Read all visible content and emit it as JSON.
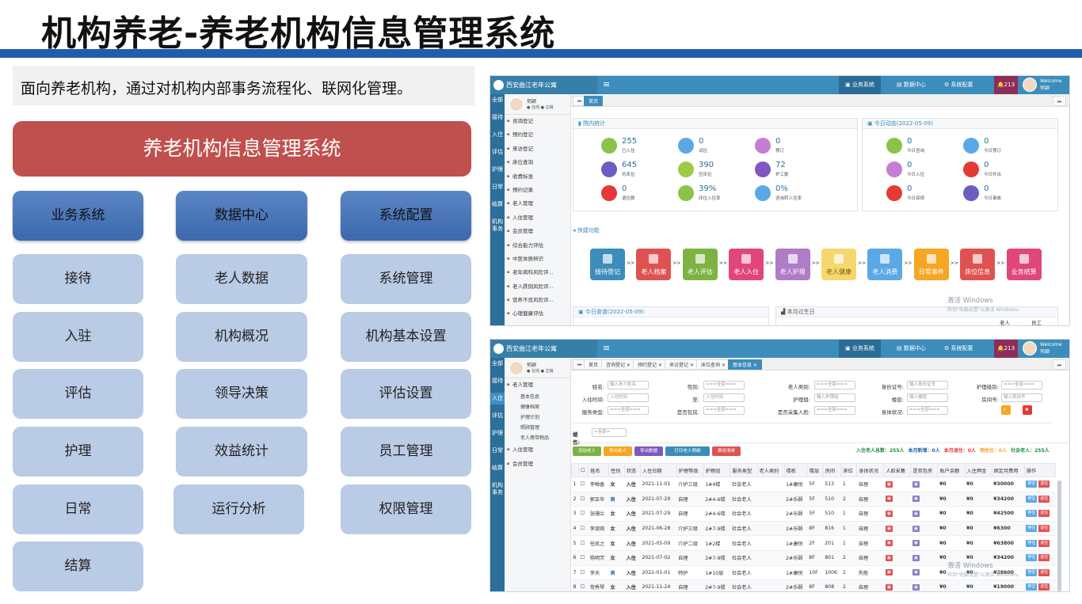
{
  "slide": {
    "title": "机构养老-养老机构信息管理系统",
    "intro": "面向养老机构，通过对机构内部事务流程化、联网化管理。",
    "banner": "养老机构信息管理系统"
  },
  "modules": {
    "headers": [
      "业务系统",
      "数据中心",
      "系统配置"
    ],
    "col1": [
      "接待",
      "入驻",
      "评估",
      "护理",
      "日常",
      "结算"
    ],
    "col2": [
      "老人数据",
      "机构概况",
      "领导决策",
      "效益统计",
      "运行分析"
    ],
    "col3": [
      "系统管理",
      "机构基本设置",
      "评估设置",
      "员工管理",
      "权限管理"
    ]
  },
  "app": {
    "logo_text": "西安曲江老年公寓",
    "nav": [
      "业务系统",
      "数据中心",
      "系统配置"
    ],
    "bell_count": "213",
    "welcome": "Welcome",
    "user": "何颖",
    "status_online": "在线",
    "status_logout": "注销",
    "leftbar": [
      "全部",
      "接待",
      "入住",
      "评估",
      "护理",
      "日常",
      "结算",
      "机构事务"
    ],
    "watermark": "激活 Windows",
    "watermark_sub": "转到\"电脑设置\"以激活 Windows。"
  },
  "shot1": {
    "tabs": [
      "首页"
    ],
    "sidebar": [
      "咨询登记",
      "预约登记",
      "来访登记",
      "床位查询",
      "收费标准",
      "预约记录",
      "老人管理",
      "入住管理",
      "会员管理",
      "综合能力评估",
      "中医体质辨识",
      "老年病科风险评...",
      "老人跌倒风险评...",
      "营养不良风险评...",
      "心理健康评估"
    ],
    "stats_title": "院内统计",
    "stats": [
      {
        "value": "255",
        "label": "已入住",
        "color": "#8bc34a"
      },
      {
        "value": "0",
        "label": "试住",
        "color": "#5aa9e6"
      },
      {
        "value": "0",
        "label": "预订",
        "color": "#c77dd3"
      },
      {
        "value": "645",
        "label": "总床位",
        "color": "#6a5fc1"
      },
      {
        "value": "390",
        "label": "空床位",
        "color": "#9ccc45"
      },
      {
        "value": "72",
        "label": "护工数",
        "color": "#7e57c2"
      },
      {
        "value": "0",
        "label": "退住数",
        "color": "#e53935"
      },
      {
        "value": "39%",
        "label": "床位入住率",
        "color": "#8bc34a"
      },
      {
        "value": "0%",
        "label": "咨询转入住率",
        "color": "#5aa9e6"
      }
    ],
    "today_title": "今日动态(2022-05-09)",
    "today": [
      {
        "value": "0",
        "label": "今日咨询",
        "color": "#8bc34a"
      },
      {
        "value": "0",
        "label": "今日预订",
        "color": "#5aa9e6"
      },
      {
        "value": "0",
        "label": "今日入住",
        "color": "#c77dd3"
      },
      {
        "value": "0",
        "label": "今日外出",
        "color": "#e53935"
      },
      {
        "value": "0",
        "label": "今日探视",
        "color": "#e53935"
      },
      {
        "value": "0",
        "label": "今日事故",
        "color": "#6a5fc1"
      }
    ],
    "quick_title": "快捷功能",
    "quick": [
      {
        "label": "接待登记",
        "color": "#3c8dbc"
      },
      {
        "label": "老人档案",
        "color": "#e05252"
      },
      {
        "label": "老人评估",
        "color": "#7cb342"
      },
      {
        "label": "老人入住",
        "color": "#e0457b"
      },
      {
        "label": "老人护理",
        "color": "#b07cc6"
      },
      {
        "label": "老人健康",
        "color": "#f5d76e"
      },
      {
        "label": "老人消费",
        "color": "#5aa9e6"
      },
      {
        "label": "日常事件",
        "color": "#f5a623"
      },
      {
        "label": "床位信息",
        "color": "#e05252"
      },
      {
        "label": "业务结算",
        "color": "#e0457b"
      }
    ],
    "menu_title": "今日食谱(2022-05-09)",
    "birthday_title": "本月过生日",
    "birthday_cols": [
      "老人",
      "员工"
    ]
  },
  "shot2": {
    "tabs": [
      "首页",
      "咨询登记",
      "预约登记",
      "来访登记",
      "床位查询",
      "基本信息"
    ],
    "sidebar_head": "老人管理",
    "sidebar_sub": [
      "基本信息",
      "健康档案",
      "护理计划",
      "照顾管理",
      "老人携带物品"
    ],
    "sidebar_more": [
      "入住管理",
      "会员管理"
    ],
    "form": {
      "name_label": "姓名:",
      "name_ph": "输入老人姓名",
      "sex_label": "性别:",
      "sex_val": "===全部===",
      "type_label": "老人类别:",
      "type_val": "===全部===",
      "id_label": "身份证号:",
      "id_ph": "输入身份证号",
      "level_label": "护理级别:",
      "level_val": "===全部===",
      "time_label": "入住时间:",
      "time_ph": "入住时间",
      "to_label": "至:",
      "to_ph": "入住时间",
      "group_label": "护理组:",
      "group_ph": "输入护理组",
      "floor_label": "楼层:",
      "floor_ph": "输入楼层",
      "room_label": "房间号:",
      "room_ph": "输入房间号",
      "svc_label": "服务类型:",
      "svc_val": "===全部===",
      "pkg_label": "是否包房:",
      "pkg_val": "===全部===",
      "face_label": "是否采集人脸:",
      "face_val": "===全部===",
      "body_label": "身体状况:",
      "body_val": "===全部===",
      "query_btn": "查询",
      "reset_btn": "重置",
      "building_label": "楼栋:",
      "building_val": "=全部="
    },
    "actions": [
      "添加老人",
      "导出老人",
      "导出数据",
      "打印老人明细",
      "费用清单"
    ],
    "summary": [
      {
        "text": "入住老人总数：255人",
        "color": "#1e8e3e"
      },
      {
        "text": "本月新增：0人",
        "color": "#1f5db0"
      },
      {
        "text": "本月退住：0人",
        "color": "#e53935"
      },
      {
        "text": "预收住：0人",
        "color": "#f5a623"
      },
      {
        "text": "社会老人：255人",
        "color": "#1e8e3e"
      }
    ],
    "columns": [
      "",
      "",
      "姓名",
      "性别",
      "状态",
      "入住日期",
      "护理等级",
      "护理组",
      "服务类型",
      "老人类别",
      "楼栋",
      "楼层",
      "房间",
      "床位",
      "身体状况",
      "人脸采集",
      "是否包房",
      "账户余额",
      "入住押金",
      "固定月费用",
      "操作"
    ],
    "rows": [
      {
        "no": "1",
        "name": "李梅香",
        "sex": "女",
        "status": "入住",
        "date": "2021-11-01",
        "level": "介护三级",
        "group": "1#4楼",
        "svc": "社会老人",
        "type": "",
        "bld": "1#康悦",
        "floor": "5F",
        "room": "513",
        "bed": "1",
        "body": "自理",
        "bal": "¥0",
        "dep": "¥0",
        "fee": "¥30000"
      },
      {
        "no": "2",
        "name": "郭正华",
        "sex": "男",
        "status": "入住",
        "date": "2021-07-29",
        "level": "自理",
        "group": "2#4-6楼",
        "svc": "社会老人",
        "type": "",
        "bld": "2#乐颐",
        "floor": "5F",
        "room": "510",
        "bed": "2",
        "body": "自理",
        "bal": "¥0",
        "dep": "¥0",
        "fee": "¥34200"
      },
      {
        "no": "3",
        "name": "张珊兰",
        "sex": "女",
        "status": "入住",
        "date": "2021-07-29",
        "level": "自理",
        "group": "2#4-6楼",
        "svc": "社会老人",
        "type": "",
        "bld": "2#乐颐",
        "floor": "5F",
        "room": "510",
        "bed": "1",
        "body": "自理",
        "bal": "¥0",
        "dep": "¥0",
        "fee": "¥42500"
      },
      {
        "no": "4",
        "name": "李淑琦",
        "sex": "女",
        "status": "入住",
        "date": "2021-06-28",
        "level": "介护三级",
        "group": "2#7-9楼",
        "svc": "社会老人",
        "type": "",
        "bld": "2#乐颐",
        "floor": "8F",
        "room": "816",
        "bed": "1",
        "body": "自理",
        "bal": "¥0",
        "dep": "¥0",
        "fee": "¥6300"
      },
      {
        "no": "5",
        "name": "任凯之",
        "sex": "女",
        "status": "入住",
        "date": "2021-05-09",
        "level": "介护二级",
        "group": "1#2楼",
        "svc": "社会老人",
        "type": "",
        "bld": "1#康悦",
        "floor": "2F",
        "room": "201",
        "bed": "1",
        "body": "自理",
        "bal": "¥0",
        "dep": "¥0",
        "fee": "¥63800"
      },
      {
        "no": "6",
        "name": "杨明芳",
        "sex": "女",
        "status": "入住",
        "date": "2021-07-02",
        "level": "自理",
        "group": "2#7-9楼",
        "svc": "社会老人",
        "type": "",
        "bld": "2#乐颐",
        "floor": "8F",
        "room": "801",
        "bed": "2",
        "body": "自理",
        "bal": "¥0",
        "dep": "¥0",
        "fee": "¥34200"
      },
      {
        "no": "7",
        "name": "李天",
        "sex": "男",
        "status": "入住",
        "date": "2022-01-01",
        "level": "特护",
        "group": "1#10层",
        "svc": "社会老人",
        "type": "",
        "bld": "1#康悦",
        "floor": "10F",
        "room": "1006",
        "bed": "2",
        "body": "失能",
        "bal": "¥0",
        "dep": "¥0",
        "fee": "¥28600"
      },
      {
        "no": "8",
        "name": "常秀琴",
        "sex": "女",
        "status": "入住",
        "date": "2021-11-24",
        "level": "自理",
        "group": "2#7-9楼",
        "svc": "社会老人",
        "type": "",
        "bld": "2#乐颐",
        "floor": "8F",
        "room": "808",
        "bed": "2",
        "body": "自理",
        "bal": "¥0",
        "dep": "¥0",
        "fee": "¥19000"
      }
    ],
    "row_actions": [
      "停住",
      "退住"
    ]
  }
}
